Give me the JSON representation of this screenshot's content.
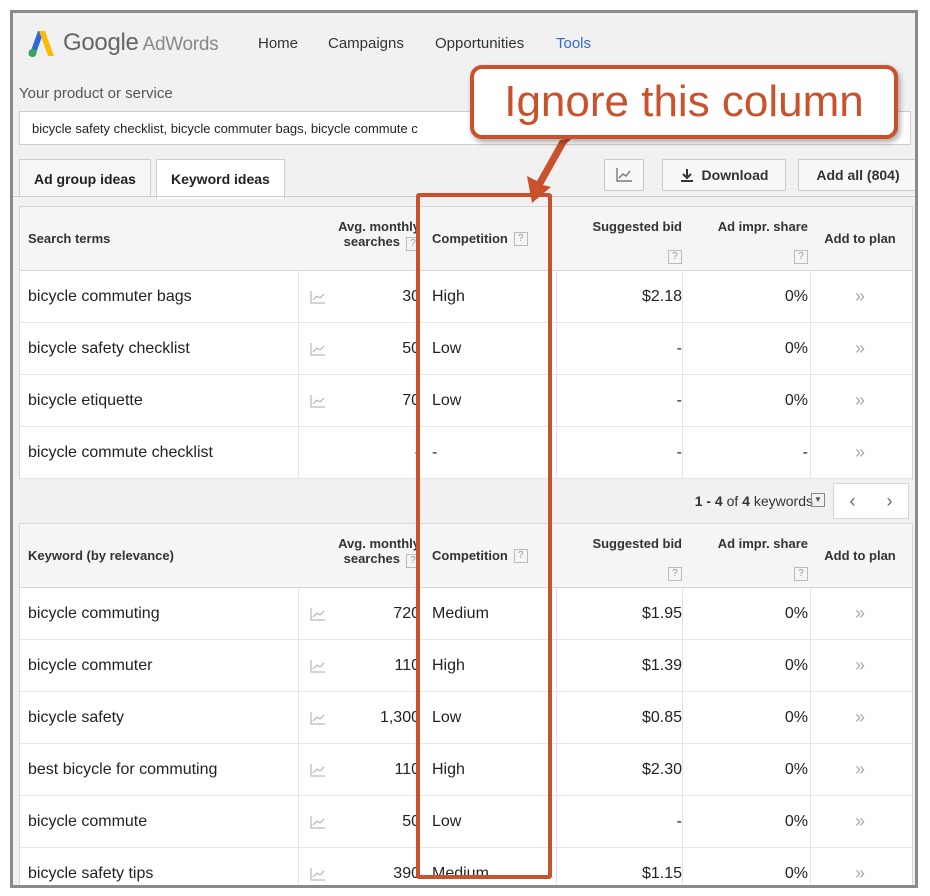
{
  "app": {
    "logo_text": "Google",
    "logo_sub": "AdWords",
    "nav": [
      "Home",
      "Campaigns",
      "Opportunities",
      "Tools"
    ],
    "active_nav": "Tools",
    "brand_colors": {
      "blue": "#2f69d9",
      "green": "#34a853",
      "yellow": "#fbbc05"
    }
  },
  "product": {
    "label": "Your product or service",
    "value": "bicycle safety checklist, bicycle commuter bags, bicycle commute c"
  },
  "tabs": {
    "ad_group": "Ad group ideas",
    "keyword": "Keyword ideas",
    "active": "Keyword ideas"
  },
  "toolbar": {
    "chart_icon": "line-chart-icon",
    "download_label": "Download",
    "download_icon": "download-icon",
    "add_all_label": "Add all (804)"
  },
  "headers": {
    "search_terms": "Search terms",
    "keyword_relevance": "Keyword (by relevance)",
    "avg_monthly_1": "Avg. monthly",
    "avg_monthly_2": "searches",
    "competition": "Competition",
    "suggested_bid": "Suggested bid",
    "ad_impr_share": "Ad impr. share",
    "add_to_plan": "Add to plan",
    "help": "?"
  },
  "search_terms": [
    {
      "term": "bicycle commuter bags",
      "avg": "30",
      "competition": "High",
      "bid": "$2.18",
      "impr": "0%",
      "spark": true
    },
    {
      "term": "bicycle safety checklist",
      "avg": "50",
      "competition": "Low",
      "bid": "-",
      "impr": "0%",
      "spark": true
    },
    {
      "term": "bicycle etiquette",
      "avg": "70",
      "competition": "Low",
      "bid": "-",
      "impr": "0%",
      "spark": true
    },
    {
      "term": "bicycle commute checklist",
      "avg": "-",
      "competition": "-",
      "bid": "-",
      "impr": "-",
      "spark": false
    }
  ],
  "pager": {
    "range": "1 - 4",
    "of": "of",
    "total": "4",
    "unit": "keywords"
  },
  "keywords": [
    {
      "term": "bicycle commuting",
      "avg": "720",
      "competition": "Medium",
      "bid": "$1.95",
      "impr": "0%"
    },
    {
      "term": "bicycle commuter",
      "avg": "110",
      "competition": "High",
      "bid": "$1.39",
      "impr": "0%"
    },
    {
      "term": "bicycle safety",
      "avg": "1,300",
      "competition": "Low",
      "bid": "$0.85",
      "impr": "0%"
    },
    {
      "term": "best bicycle for commuting",
      "avg": "110",
      "competition": "High",
      "bid": "$2.30",
      "impr": "0%"
    },
    {
      "term": "bicycle commute",
      "avg": "50",
      "competition": "Low",
      "bid": "-",
      "impr": "0%"
    },
    {
      "term": "bicycle safety tips",
      "avg": "390",
      "competition": "Medium",
      "bid": "$1.15",
      "impr": "0%"
    }
  ],
  "add_symbol": "»",
  "annotation": {
    "text": "Ignore this column",
    "color": "#c9512c"
  }
}
